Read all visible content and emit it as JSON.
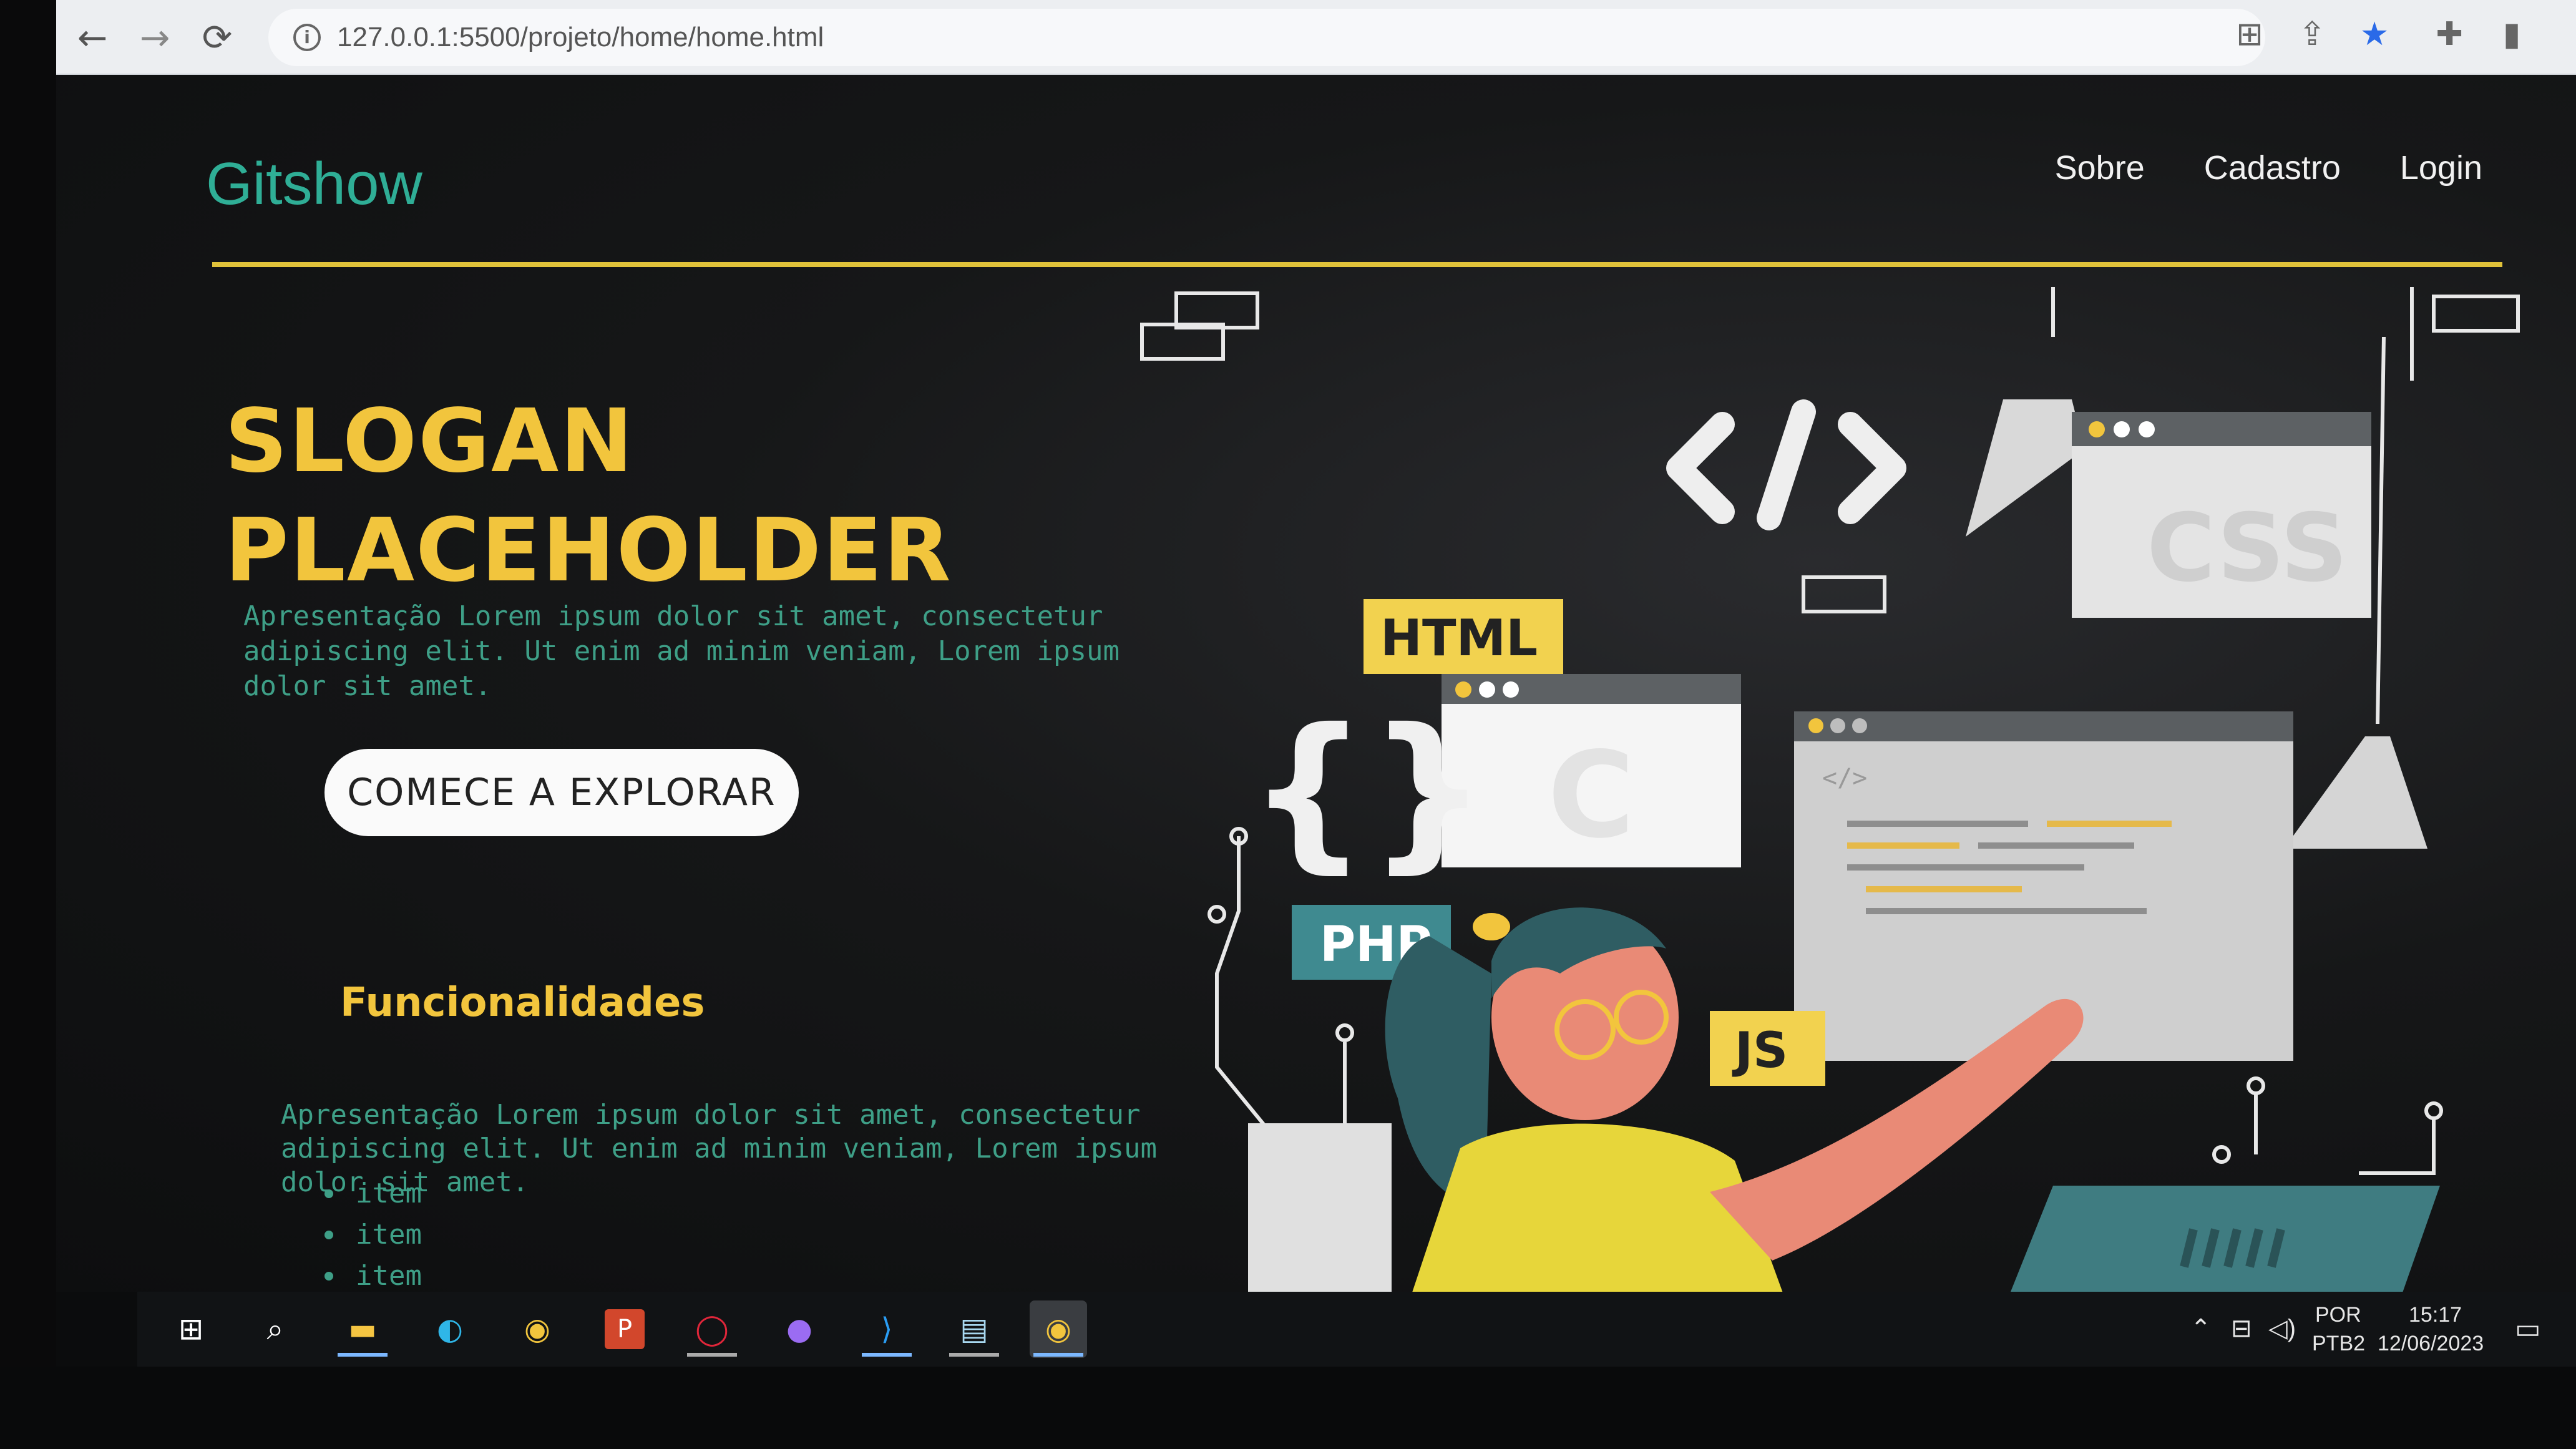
{
  "browser": {
    "url": "127.0.0.1:5500/projeto/home/home.html",
    "back_icon": "arrow-left-icon",
    "forward_icon": "arrow-right-icon",
    "reload_icon": "reload-icon"
  },
  "header": {
    "brand": "Gitshow",
    "nav": [
      "Sobre",
      "Cadastro",
      "Login"
    ],
    "brand_color": "#2fae96",
    "divider_color": "#e0c23a"
  },
  "hero": {
    "slogan_line1": "SLOGAN",
    "slogan_line2": "PLACEHOLDER",
    "intro": "Apresentação Lorem ipsum dolor sit amet, consectetur adipiscing elit. Ut enim ad minim veniam, Lorem ipsum dolor sit amet.",
    "cta_label": "COMECE A EXPLORAR",
    "accent_color": "#f2c53d"
  },
  "features": {
    "title": "Funcionalidades",
    "text": "Apresentação Lorem ipsum dolor sit amet, consectetur adipiscing elit. Ut enim ad minim veniam, Lorem ipsum dolor sit amet.",
    "items": [
      "item",
      "item",
      "item"
    ]
  },
  "illustration": {
    "tags": {
      "html": "HTML",
      "php": "PHP",
      "js": "JS",
      "css": "CSS",
      "code_symbol": "</>",
      "braces": "{}",
      "c_letter": "C"
    }
  },
  "taskbar": {
    "language": "POR",
    "layout": "PTB2",
    "time": "15:17",
    "date": "12/06/2023"
  }
}
